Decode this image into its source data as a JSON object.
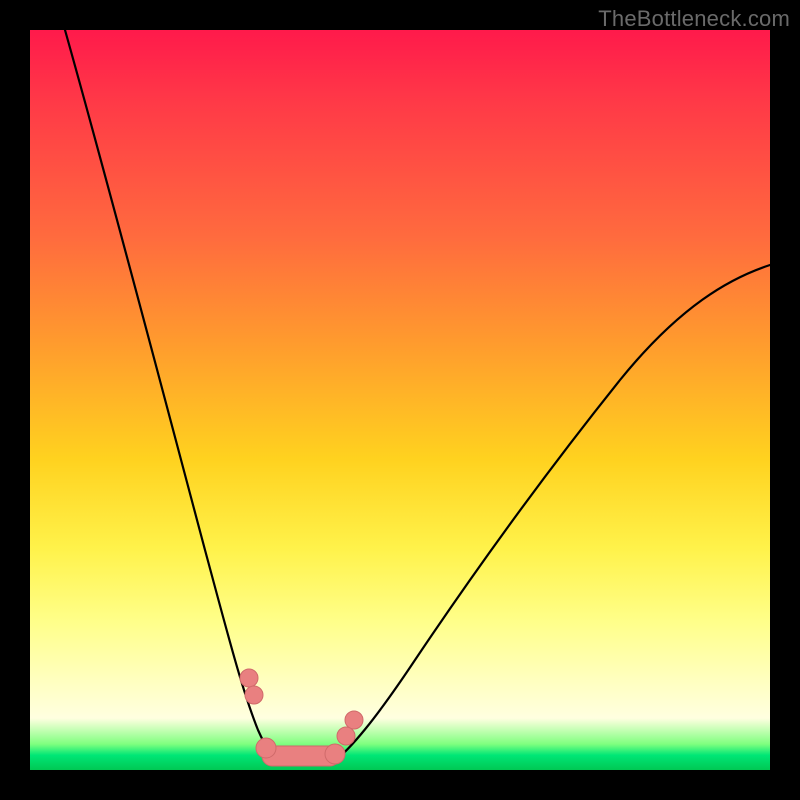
{
  "watermark": "TheBottleneck.com",
  "chart_data": {
    "type": "line",
    "title": "",
    "xlabel": "",
    "ylabel": "",
    "xlim": [
      0,
      100
    ],
    "ylim": [
      0,
      100
    ],
    "grid": false,
    "legend": false,
    "background_gradient": [
      "#ff1a4b",
      "#ff6b3e",
      "#ffd21f",
      "#ffffe0",
      "#00c853"
    ],
    "series": [
      {
        "name": "left-descending-curve",
        "x": [
          4,
          8,
          12,
          16,
          20,
          24,
          27,
          29,
          31,
          33
        ],
        "y": [
          100,
          84,
          66,
          48,
          32,
          18,
          10,
          5,
          2,
          0
        ]
      },
      {
        "name": "right-ascending-curve",
        "x": [
          40,
          44,
          50,
          58,
          66,
          74,
          82,
          90,
          97,
          100
        ],
        "y": [
          0,
          3,
          8,
          16,
          26,
          37,
          48,
          58,
          65,
          68
        ]
      }
    ],
    "markers": {
      "color": "#e98080",
      "points": [
        {
          "x": 28.5,
          "y": 12
        },
        {
          "x": 29.5,
          "y": 9
        },
        {
          "x": 42.5,
          "y": 7
        },
        {
          "x": 44.0,
          "y": 10
        }
      ],
      "bottom_segment": {
        "x_start": 30,
        "x_end": 41,
        "y": 2
      }
    }
  }
}
